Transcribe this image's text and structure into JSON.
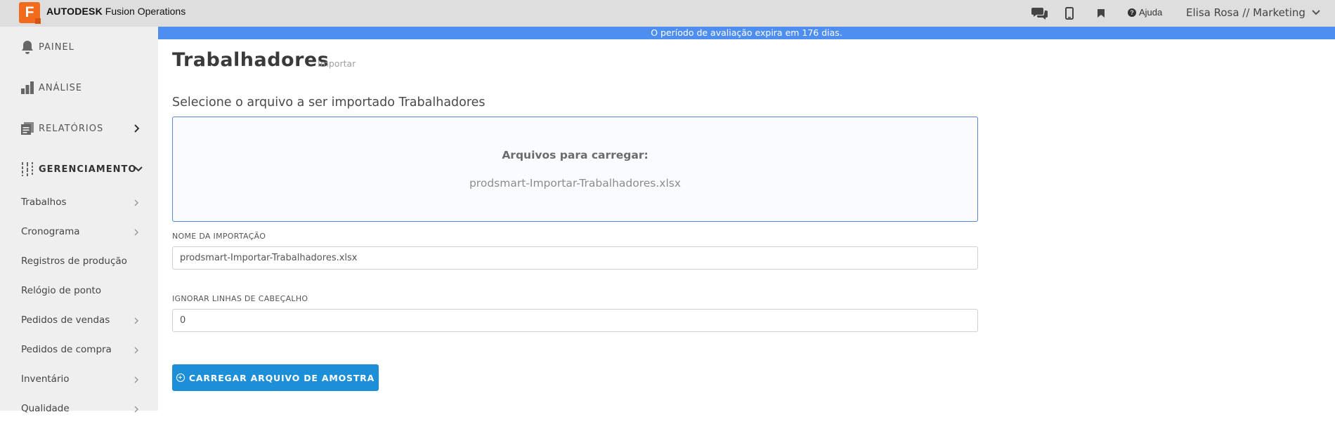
{
  "app": {
    "logo_letter": "F",
    "brand_bold": "AUTODESK",
    "brand_rest": "Fusion Operations",
    "help_label": "Ajuda",
    "user_label": "Elisa Rosa // Marketing"
  },
  "banner": {
    "text": "O período de avaliação expira em 176 dias."
  },
  "sidebar": {
    "main": [
      {
        "label": "PAINEL",
        "icon": "bell-icon"
      },
      {
        "label": "ANÁLISE",
        "icon": "bar-chart-icon"
      },
      {
        "label": "RELATÓRIOS",
        "icon": "report-icon"
      },
      {
        "label": "GERENCIAMENTO",
        "icon": "sliders-icon"
      }
    ],
    "sub": [
      {
        "label": "Trabalhos"
      },
      {
        "label": "Cronograma"
      },
      {
        "label": "Registros de produção"
      },
      {
        "label": "Relógio de ponto"
      },
      {
        "label": "Pedidos de vendas"
      },
      {
        "label": "Pedidos de compra"
      },
      {
        "label": "Inventário"
      },
      {
        "label": "Qualidade"
      }
    ]
  },
  "main": {
    "title": "Trabalhadores",
    "subtitle": "Importar",
    "section_title": "Selecione o arquivo a ser importado Trabalhadores",
    "dropzone": {
      "label": "Arquivos para carregar:",
      "file": "prodsmart-Importar-Trabalhadores.xlsx"
    },
    "import_name": {
      "label": "NOME DA IMPORTAÇÃO",
      "value": "prodsmart-Importar-Trabalhadores.xlsx"
    },
    "header_rows": {
      "label": "IGNORAR LINHAS DE CABEÇALHO",
      "value": "0"
    },
    "upload_button": "CARREGAR ARQUIVO DE AMOSTRA"
  },
  "colors": {
    "brand_orange": "#f26b1d",
    "banner_blue": "#4d8ef0",
    "button_blue": "#1d8fd8",
    "sidebar_bg": "#efefef",
    "topbar_bg": "#dedede"
  }
}
